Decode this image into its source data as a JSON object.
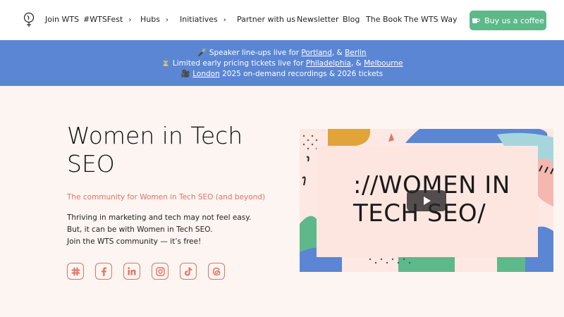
{
  "nav": {
    "items": [
      {
        "label": "Join WTS",
        "chevron": false
      },
      {
        "label": "#WTSFest",
        "chevron": true
      },
      {
        "label": "Hubs",
        "chevron": true
      },
      {
        "label": "Initiatives",
        "chevron": true
      },
      {
        "label": "Partner with us",
        "chevron": false
      },
      {
        "label": "Newsletter",
        "chevron": false
      },
      {
        "label": "Blog",
        "chevron": false
      },
      {
        "label": "The Book",
        "chevron": false
      },
      {
        "label": "The WTS Way",
        "chevron": false
      }
    ],
    "chevron_glyph": "›",
    "coffee_button": "Buy us a coffee"
  },
  "banner": {
    "line1": {
      "icon": "🎤",
      "text": "Speaker line-ups live for",
      "link1": "Portland",
      "sep": ", &",
      "link2": "Berlin"
    },
    "line2": {
      "icon": "⏳",
      "text": "Limited early pricing tickets live for",
      "link1": "Philadelphia",
      "sep": ", &",
      "link2": "Melbourne"
    },
    "line3": {
      "icon": "🎥",
      "link1": "London",
      "text": "2025 on-demand recordings & 2026 tickets"
    }
  },
  "hero": {
    "title": "Women in Tech SEO",
    "tagline": "The community for Women in Tech SEO (and beyond)",
    "body": [
      "Thriving in marketing and tech may not feel easy.",
      "But, it can be with Women in Tech SEO.",
      "Join the WTS community — it’s free!"
    ]
  },
  "socials": [
    "slack-icon",
    "facebook-icon",
    "linkedin-icon",
    "instagram-icon",
    "tiktok-icon",
    "threads-icon"
  ],
  "video": {
    "title_line1": "://WOMEN IN",
    "title_line2": "TECH SEO/"
  },
  "colors": {
    "banner": "#5b86d4",
    "accent": "#e07363",
    "coffee": "#5fb889",
    "background": "#fdf5f2"
  }
}
